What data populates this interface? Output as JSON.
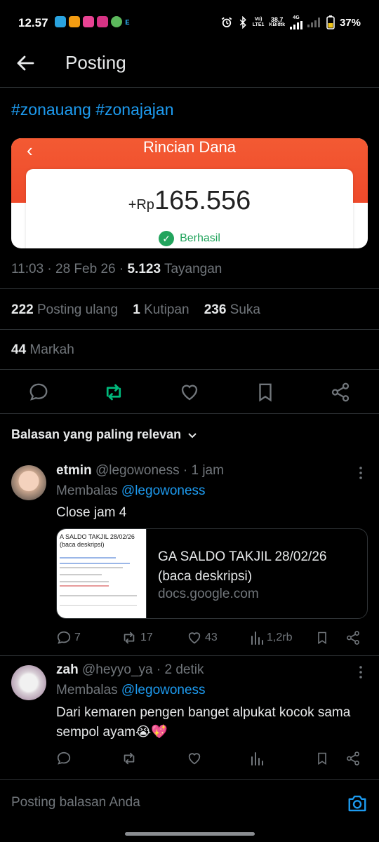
{
  "status_bar": {
    "time": "12.57",
    "network_line1": "Vo)",
    "network_line2": "LTE1",
    "speed_value": "38,7",
    "speed_unit": "KB/dtk",
    "network_type": "4G",
    "battery": "37%"
  },
  "header": {
    "title": "Posting"
  },
  "post": {
    "text": "#zonauang #zonajajan",
    "image": {
      "title": "Rincian Dana",
      "currency": "+Rp",
      "amount": "165.556",
      "status": "Berhasil"
    },
    "time_meta": "11:03 · 28 Feb 26 · ",
    "views": "5.123",
    "views_label": " Tayangan",
    "reposts": "222",
    "reposts_label": " Posting ulang",
    "quotes": "1",
    "quotes_label": " Kutipan",
    "likes": "236",
    "likes_label": " Suka",
    "bookmarks": "44",
    "bookmarks_label": " Markah"
  },
  "colors": {
    "accent": "#1d9bf0",
    "repost_active": "#00ba7c",
    "text_dim": "#71767b"
  },
  "sort_label": "Balasan yang paling relevan",
  "replies": [
    {
      "name": "etmin",
      "handle": "@legowoness · 1 jam",
      "replying_prefix": "Membalas ",
      "replying_to": "@legowoness",
      "text": "Close jam 4",
      "link_card": {
        "title": "GA SALDO TAKJIL 28/02/26 (baca deskripsi)",
        "domain": "docs.google.com",
        "thumb_heading": "A SALDO TAKJIL 28/02/26 (baca deskripsi)"
      },
      "replies_count": "7",
      "reposts_count": "17",
      "likes_count": "43",
      "views_count": "1,2rb"
    },
    {
      "name": "zah",
      "handle": "@heyyo_ya · 2 detik",
      "replying_prefix": "Membalas ",
      "replying_to": "@legowoness",
      "text": "Dari kemaren pengen banget alpukat kocok sama sempol ayam😭💖"
    }
  ],
  "composer": {
    "placeholder": "Posting balasan Anda"
  }
}
